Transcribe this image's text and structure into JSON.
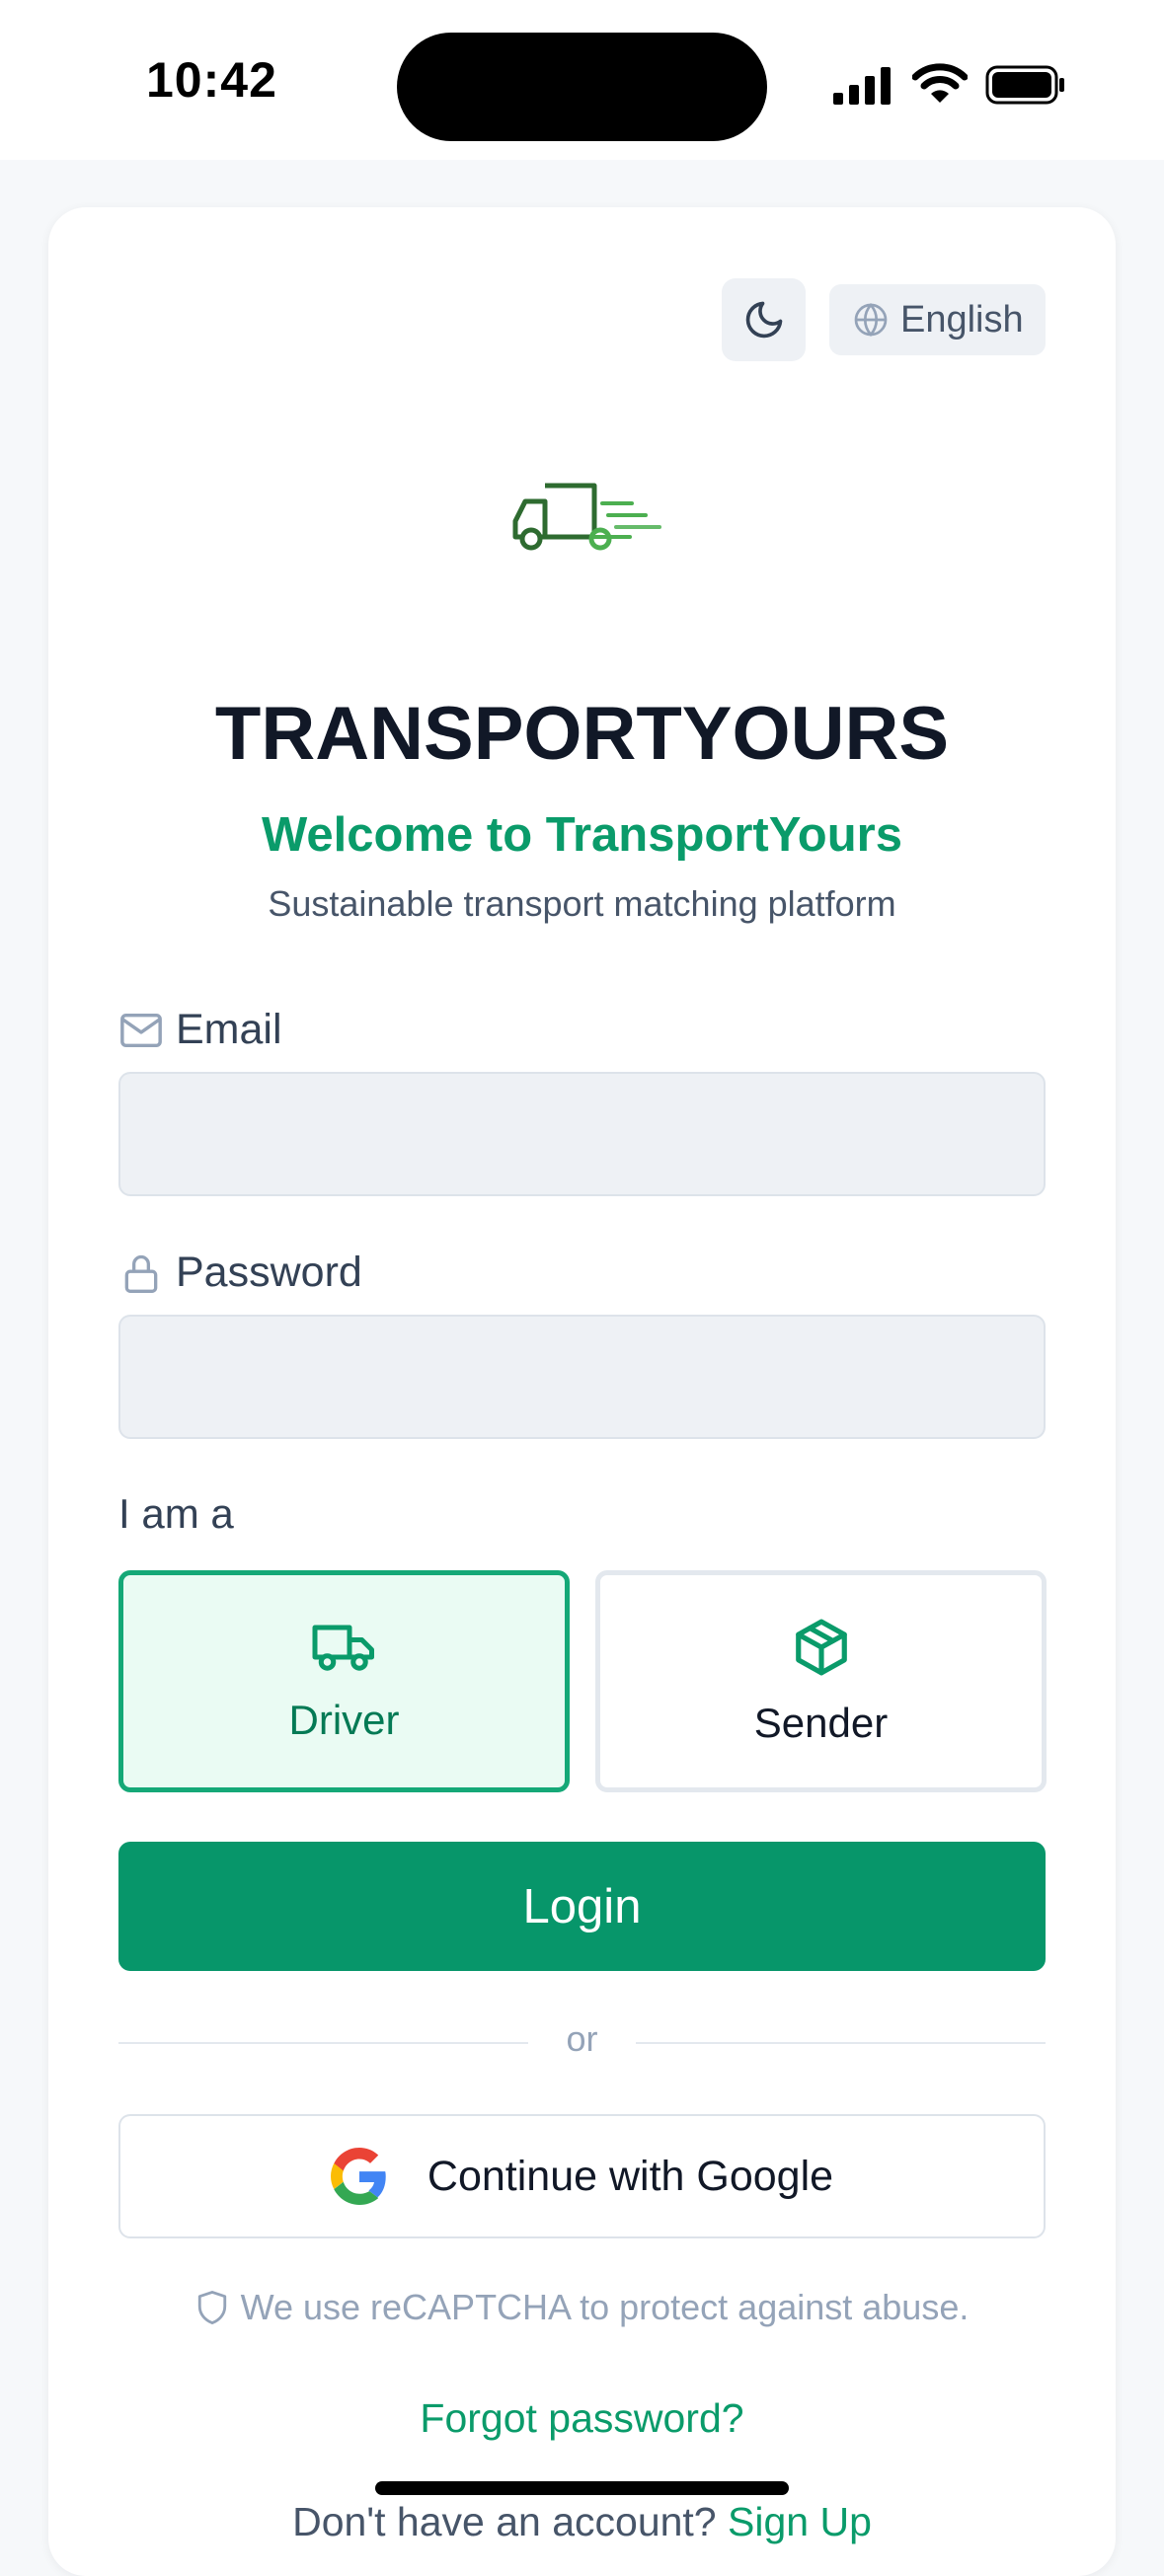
{
  "status_bar": {
    "time": "10:42"
  },
  "header": {
    "language": "English"
  },
  "brand": {
    "name": "TRANSPORTYOURS",
    "welcome": "Welcome to TransportYours",
    "tagline": "Sustainable transport matching platform"
  },
  "form": {
    "email_label": "Email",
    "email_value": "",
    "password_label": "Password",
    "password_value": "",
    "role_label": "I am a",
    "roles": [
      {
        "label": "Driver",
        "selected": true
      },
      {
        "label": "Sender",
        "selected": false
      }
    ],
    "login_label": "Login",
    "divider": "or",
    "google_label": "Continue with Google",
    "recaptcha_note": "We use reCAPTCHA to protect against abuse.",
    "forgot_label": "Forgot password?",
    "signup_prompt": "Don't have an account?",
    "signup_label": "Sign Up"
  },
  "colors": {
    "accent": "#07966a",
    "accent_text": "#0a9b6a",
    "selected_bg": "#eafbf3"
  }
}
